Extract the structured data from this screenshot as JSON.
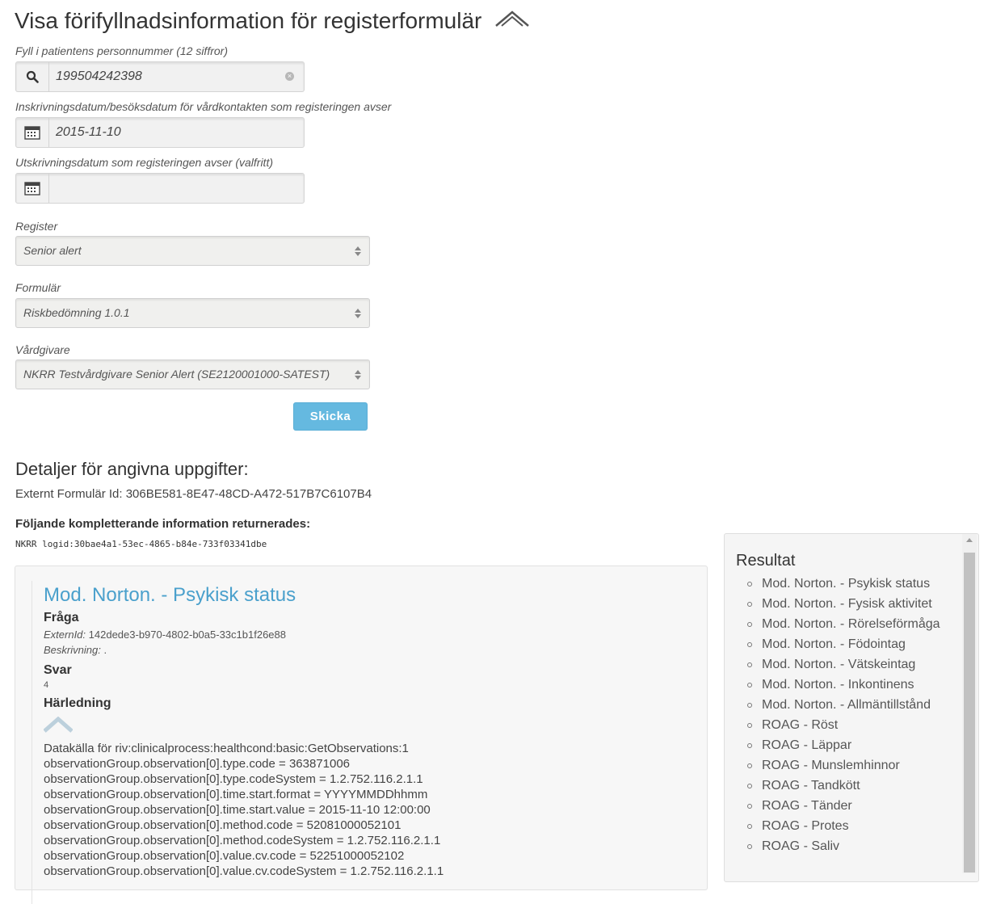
{
  "page": {
    "title": "Visa förifyllnadsinformation för registerformulär"
  },
  "form": {
    "personnummer_label": "Fyll i patientens personnummer (12 siffror)",
    "personnummer_value": "199504242398",
    "inskrivning_label": "Inskrivningsdatum/besöksdatum för vårdkontakten som registeringen avser",
    "inskrivning_value": "2015-11-10",
    "utskrivning_label": "Utskrivningsdatum som registeringen avser (valfritt)",
    "utskrivning_value": "",
    "register_label": "Register",
    "register_value": "Senior alert",
    "formular_label": "Formulär",
    "formular_value": "Riskbedömning 1.0.1",
    "vardgivare_label": "Vårdgivare",
    "vardgivare_value": "NKRR Testvårdgivare Senior Alert (SE2120001000-SATEST)",
    "submit_label": "Skicka"
  },
  "details": {
    "heading": "Detaljer för angivna uppgifter:",
    "external_id": "Externt Formulär Id: 306BE581-8E47-48CD-A472-517B7C6107B4",
    "komp_heading": "Följande kompletterande information returnerades:",
    "logid": "NKRR logid:30bae4a1-53ec-4865-b84e-733f03341dbe"
  },
  "card": {
    "title": "Mod. Norton. - Psykisk status",
    "fraga_label": "Fråga",
    "external_id_key": "ExternId:",
    "external_id_value": "142dede3-b970-4802-b0a5-33c1b1f26e88",
    "beskrivning_key": "Beskrivning:",
    "beskrivning_value": ".",
    "svar_label": "Svar",
    "svar_value": "4",
    "harledning_label": "Härledning",
    "derivation_lines": [
      "Datakälla för riv:clinicalprocess:healthcond:basic:GetObservations:1",
      "observationGroup.observation[0].type.code = 363871006",
      "observationGroup.observation[0].type.codeSystem = 1.2.752.116.2.1.1",
      "observationGroup.observation[0].time.start.format = YYYYMMDDhhmm",
      "observationGroup.observation[0].time.start.value = 2015-11-10 12:00:00",
      "observationGroup.observation[0].method.code = 52081000052101",
      "observationGroup.observation[0].method.codeSystem = 1.2.752.116.2.1.1",
      "observationGroup.observation[0].value.cv.code = 52251000052102",
      "observationGroup.observation[0].value.cv.codeSystem = 1.2.752.116.2.1.1"
    ]
  },
  "results": {
    "title": "Resultat",
    "items": [
      "Mod. Norton. - Psykisk status",
      "Mod. Norton. - Fysisk aktivitet",
      "Mod. Norton. - Rörelseförmåga",
      "Mod. Norton. - Födointag",
      "Mod. Norton. - Vätskeintag",
      "Mod. Norton. - Inkontinens",
      "Mod. Norton. - Allmäntillstånd",
      "ROAG - Röst",
      "ROAG - Läppar",
      "ROAG - Munslemhinnor",
      "ROAG - Tandkött",
      "ROAG - Tänder",
      "ROAG - Protes",
      "ROAG - Saliv"
    ]
  },
  "colors": {
    "accent": "#65b9e0",
    "title_link": "#4aa0cc"
  }
}
